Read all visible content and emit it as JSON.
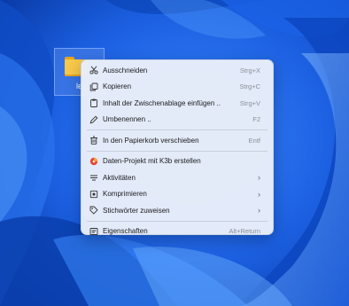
{
  "desktop": {
    "folder_label": "le"
  },
  "menu": {
    "items_top": [
      {
        "label": "Ausschneiden",
        "shortcut": "Strg+X",
        "icon": "scissors-icon"
      },
      {
        "label": "Kopieren",
        "shortcut": "Strg+C",
        "icon": "copy-icon"
      },
      {
        "label": "Inhalt der Zwischenablage einfügen ..",
        "shortcut": "Strg+V",
        "icon": "paste-icon"
      },
      {
        "label": "Umbenennen ..",
        "shortcut": "F2",
        "icon": "rename-pencil-icon"
      }
    ],
    "items_trash": [
      {
        "label": "In den Papierkorb verschieben",
        "shortcut": "Entf",
        "icon": "trash-icon"
      }
    ],
    "items_actions": [
      {
        "label": "Daten-Projekt mit K3b erstellen",
        "icon": "k3b-disc-icon"
      },
      {
        "label": "Aktivitäten",
        "submenu": "›",
        "icon": "activities-icon"
      },
      {
        "label": "Komprimieren",
        "submenu": "›",
        "icon": "archive-icon"
      },
      {
        "label": "Stichwörter zuweisen",
        "submenu": "›",
        "icon": "tag-icon"
      }
    ],
    "items_props": [
      {
        "label": "Eigenschaften",
        "shortcut": "Alt+Return",
        "icon": "properties-icon"
      }
    ]
  },
  "colors": {
    "wallpaper_base": "#1556d6",
    "menu_background": "#e9eef9",
    "menu_text": "#1b1b1b",
    "shortcut_text": "#8a8f99",
    "folder_yellow": "#f7c94a"
  }
}
